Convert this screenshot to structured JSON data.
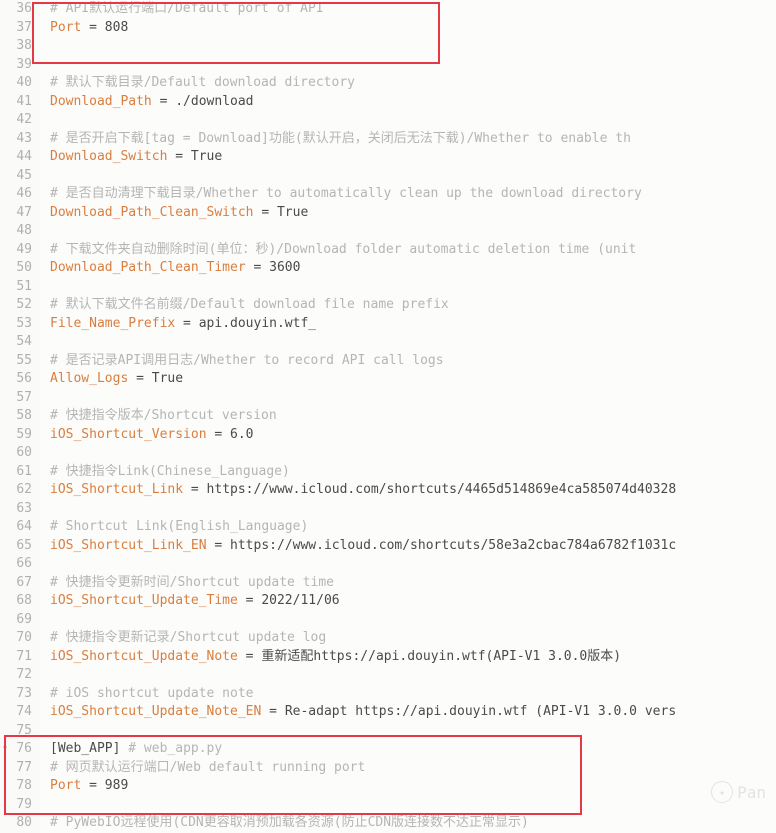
{
  "lines": [
    {
      "num": "36",
      "type": "comment",
      "text": "# API默认运行端口/Default port of API"
    },
    {
      "num": "37",
      "type": "assign",
      "var": "Port",
      "val": "808"
    },
    {
      "num": "38",
      "type": "blank",
      "text": ""
    },
    {
      "num": "39",
      "type": "blank",
      "text": ""
    },
    {
      "num": "40",
      "type": "comment",
      "text": "# 默认下载目录/Default download directory"
    },
    {
      "num": "41",
      "type": "assign",
      "var": "Download_Path",
      "val": "./download"
    },
    {
      "num": "42",
      "type": "blank",
      "text": ""
    },
    {
      "num": "43",
      "type": "comment",
      "text": "# 是否开启下载[tag = Download]功能(默认开启，关闭后无法下载)/Whether to enable th"
    },
    {
      "num": "44",
      "type": "assign",
      "var": "Download_Switch",
      "val": "True"
    },
    {
      "num": "45",
      "type": "blank",
      "text": ""
    },
    {
      "num": "46",
      "type": "comment",
      "text": "# 是否自动清理下载目录/Whether to automatically clean up the download directory"
    },
    {
      "num": "47",
      "type": "assign",
      "var": "Download_Path_Clean_Switch",
      "val": "True"
    },
    {
      "num": "48",
      "type": "blank",
      "text": ""
    },
    {
      "num": "49",
      "type": "comment",
      "text": "# 下载文件夹自动删除时间(单位：秒)/Download folder automatic deletion time (unit"
    },
    {
      "num": "50",
      "type": "assign",
      "var": "Download_Path_Clean_Timer",
      "val": "3600"
    },
    {
      "num": "51",
      "type": "blank",
      "text": ""
    },
    {
      "num": "52",
      "type": "comment",
      "text": "# 默认下载文件名前缀/Default download file name prefix"
    },
    {
      "num": "53",
      "type": "assign",
      "var": "File_Name_Prefix",
      "val": "api.douyin.wtf_"
    },
    {
      "num": "54",
      "type": "blank",
      "text": ""
    },
    {
      "num": "55",
      "type": "comment",
      "text": "# 是否记录API调用日志/Whether to record API call logs"
    },
    {
      "num": "56",
      "type": "assign",
      "var": "Allow_Logs",
      "val": "True"
    },
    {
      "num": "57",
      "type": "blank",
      "text": ""
    },
    {
      "num": "58",
      "type": "comment",
      "text": "# 快捷指令版本/Shortcut version"
    },
    {
      "num": "59",
      "type": "assign",
      "var": "iOS_Shortcut_Version",
      "val": "6.0"
    },
    {
      "num": "60",
      "type": "blank",
      "text": ""
    },
    {
      "num": "61",
      "type": "comment",
      "text": "# 快捷指令Link(Chinese_Language)"
    },
    {
      "num": "62",
      "type": "assign",
      "var": "iOS_Shortcut_Link",
      "val": "https://www.icloud.com/shortcuts/4465d514869e4ca585074d40328"
    },
    {
      "num": "63",
      "type": "blank",
      "text": ""
    },
    {
      "num": "64",
      "type": "comment",
      "text": "# Shortcut Link(English_Language)"
    },
    {
      "num": "65",
      "type": "assign",
      "var": "iOS_Shortcut_Link_EN",
      "val": "https://www.icloud.com/shortcuts/58e3a2cbac784a6782f1031c"
    },
    {
      "num": "66",
      "type": "blank",
      "text": ""
    },
    {
      "num": "67",
      "type": "comment",
      "text": "# 快捷指令更新时间/Shortcut update time"
    },
    {
      "num": "68",
      "type": "assign",
      "var": "iOS_Shortcut_Update_Time",
      "val": "2022/11/06"
    },
    {
      "num": "69",
      "type": "blank",
      "text": ""
    },
    {
      "num": "70",
      "type": "comment",
      "text": "# 快捷指令更新记录/Shortcut update log"
    },
    {
      "num": "71",
      "type": "assign",
      "var": "iOS_Shortcut_Update_Note",
      "val": "重新适配https://api.douyin.wtf(API-V1 3.0.0版本)"
    },
    {
      "num": "72",
      "type": "blank",
      "text": ""
    },
    {
      "num": "73",
      "type": "comment",
      "text": "# iOS shortcut update note"
    },
    {
      "num": "74",
      "type": "assign",
      "var": "iOS_Shortcut_Update_Note_EN",
      "val": "Re-adapt https://api.douyin.wtf (API-V1 3.0.0 vers"
    },
    {
      "num": "75",
      "type": "blank",
      "text": ""
    },
    {
      "num": "76",
      "type": "section",
      "text": "[Web_APP]",
      "trail": " # web_app.py",
      "fold": true
    },
    {
      "num": "77",
      "type": "comment",
      "text": "# 网页默认运行端口/Web default running port"
    },
    {
      "num": "78",
      "type": "assign",
      "var": "Port",
      "val": "989"
    },
    {
      "num": "79",
      "type": "blank",
      "text": ""
    },
    {
      "num": "80",
      "type": "comment",
      "text": "# PyWebIO远程使用(CDN更容取消预加载各资源(防止CDN版连接数不达正常显示)"
    }
  ],
  "watermark": {
    "text": "Pan"
  }
}
